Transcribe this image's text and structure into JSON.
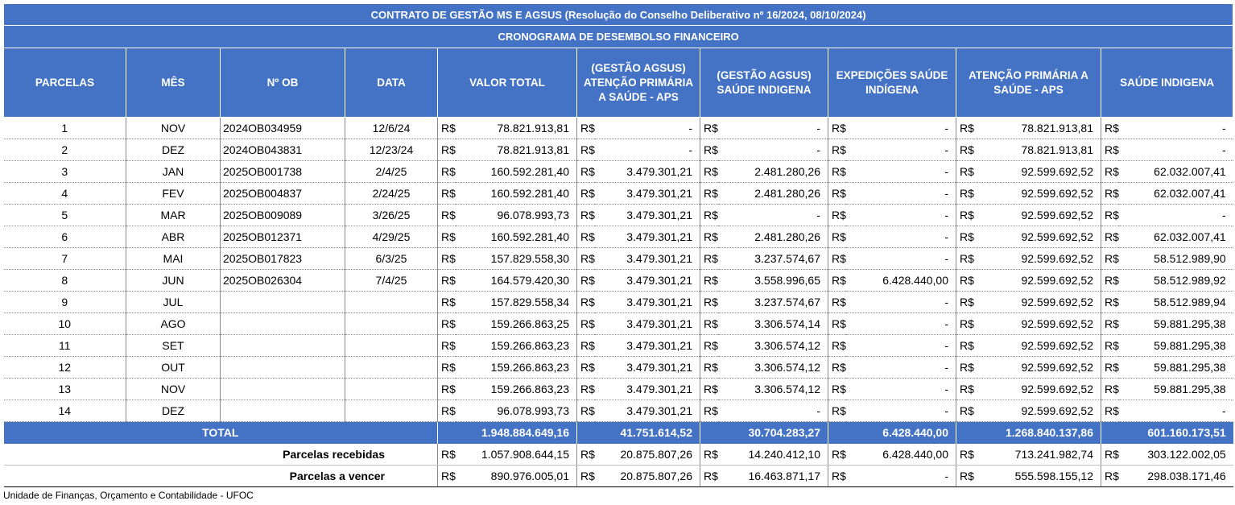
{
  "title": "CONTRATO DE GESTÃO MS E AGSUS (Resolução do Conselho Deliberativo nº 16/2024, 08/10/2024)",
  "subtitle": "CRONOGRAMA DE DESEMBOLSO FINANCEIRO",
  "headers": [
    "PARCELAS",
    "MÊS",
    "Nº OB",
    "DATA",
    "VALOR TOTAL",
    "(GESTÃO AGSUS) ATENÇÃO PRIMÁRIA A SAÚDE - APS",
    "(GESTÃO AGSUS) SAÚDE INDIGENA",
    "EXPEDIÇÕES SAÚDE INDÍGENA",
    "ATENÇÃO PRIMÁRIA A SAÚDE - APS",
    "SAÚDE INDIGENA"
  ],
  "currency": "R$",
  "rows": [
    {
      "p": "1",
      "m": "NOV",
      "ob": "2024OB034959",
      "d": "12/6/24",
      "v": [
        "78.821.913,81",
        "-",
        "-",
        "-",
        "78.821.913,81",
        "-"
      ]
    },
    {
      "p": "2",
      "m": "DEZ",
      "ob": "2024OB043831",
      "d": "12/23/24",
      "v": [
        "78.821.913,81",
        "-",
        "-",
        "-",
        "78.821.913,81",
        "-"
      ]
    },
    {
      "p": "3",
      "m": "JAN",
      "ob": "2025OB001738",
      "d": "2/4/25",
      "v": [
        "160.592.281,40",
        "3.479.301,21",
        "2.481.280,26",
        "-",
        "92.599.692,52",
        "62.032.007,41"
      ]
    },
    {
      "p": "4",
      "m": "FEV",
      "ob": "2025OB004837",
      "d": "2/24/25",
      "v": [
        "160.592.281,40",
        "3.479.301,21",
        "2.481.280,26",
        "-",
        "92.599.692,52",
        "62.032.007,41"
      ]
    },
    {
      "p": "5",
      "m": "MAR",
      "ob": "2025OB009089",
      "d": "3/26/25",
      "v": [
        "96.078.993,73",
        "3.479.301,21",
        "-",
        "-",
        "92.599.692,52",
        "-"
      ]
    },
    {
      "p": "6",
      "m": "ABR",
      "ob": "2025OB012371",
      "d": "4/29/25",
      "v": [
        "160.592.281,40",
        "3.479.301,21",
        "2.481.280,26",
        "-",
        "92.599.692,52",
        "62.032.007,41"
      ]
    },
    {
      "p": "7",
      "m": "MAI",
      "ob": "2025OB017823",
      "d": "6/3/25",
      "v": [
        "157.829.558,30",
        "3.479.301,21",
        "3.237.574,67",
        "-",
        "92.599.692,52",
        "58.512.989,90"
      ]
    },
    {
      "p": "8",
      "m": "JUN",
      "ob": "2025OB026304",
      "d": "7/4/25",
      "v": [
        "164.579.420,30",
        "3.479.301,21",
        "3.558.996,65",
        "6.428.440,00",
        "92.599.692,52",
        "58.512.989,92"
      ]
    },
    {
      "p": "9",
      "m": "JUL",
      "ob": "",
      "d": "",
      "v": [
        "157.829.558,34",
        "3.479.301,21",
        "3.237.574,67",
        "-",
        "92.599.692,52",
        "58.512.989,94"
      ]
    },
    {
      "p": "10",
      "m": "AGO",
      "ob": "",
      "d": "",
      "v": [
        "159.266.863,25",
        "3.479.301,21",
        "3.306.574,14",
        "-",
        "92.599.692,52",
        "59.881.295,38"
      ]
    },
    {
      "p": "11",
      "m": "SET",
      "ob": "",
      "d": "",
      "v": [
        "159.266.863,23",
        "3.479.301,21",
        "3.306.574,12",
        "-",
        "92.599.692,52",
        "59.881.295,38"
      ]
    },
    {
      "p": "12",
      "m": "OUT",
      "ob": "",
      "d": "",
      "v": [
        "159.266.863,23",
        "3.479.301,21",
        "3.306.574,12",
        "-",
        "92.599.692,52",
        "59.881.295,38"
      ]
    },
    {
      "p": "13",
      "m": "NOV",
      "ob": "",
      "d": "",
      "v": [
        "159.266.863,23",
        "3.479.301,21",
        "3.306.574,12",
        "-",
        "92.599.692,52",
        "59.881.295,38"
      ]
    },
    {
      "p": "14",
      "m": "DEZ",
      "ob": "",
      "d": "",
      "v": [
        "96.078.993,73",
        "3.479.301,21",
        "-",
        "-",
        "92.599.692,52",
        "-"
      ]
    }
  ],
  "total": {
    "label": "TOTAL",
    "values": [
      "1.948.884.649,16",
      "41.751.614,52",
      "30.704.283,27",
      "6.428.440,00",
      "1.268.840.137,86",
      "601.160.173,51"
    ]
  },
  "received": {
    "label": "Parcelas recebidas",
    "values": [
      "1.057.908.644,15",
      "20.875.807,26",
      "14.240.412,10",
      "6.428.440,00",
      "713.241.982,74",
      "303.122.002,05"
    ]
  },
  "pending": {
    "label": "Parcelas a vencer",
    "values": [
      "890.976.005,01",
      "20.875.807,26",
      "16.463.871,17",
      "-",
      "555.598.155,12",
      "298.038.171,46"
    ]
  },
  "footer": "Unidade de Finanças, Orçamento e Contabilidade - UFOC",
  "colors": {
    "header_bg": "#4472c4",
    "header_text": "#ffffff"
  }
}
